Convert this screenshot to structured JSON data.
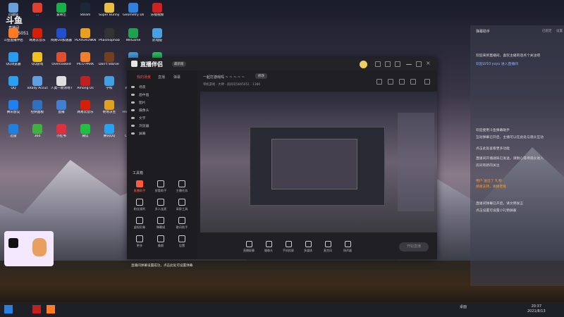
{
  "overlay": {
    "brand": "斗鱼",
    "sub": "直播间",
    "room_id": "5665051"
  },
  "desktop_icons": [
    {
      "label": "回收站",
      "color": "#6aa0d8"
    },
    {
      "label": "…",
      "color": "#e04030"
    },
    {
      "label": "爱奇艺",
      "color": "#18b048"
    },
    {
      "label": "Steam",
      "color": "#1b2838"
    },
    {
      "label": "Super Bunny Man",
      "color": "#e8c040"
    },
    {
      "label": "Geometry Dash",
      "color": "#3080e0"
    },
    {
      "label": "乐视视频",
      "color": "#d02020"
    },
    {
      "label": "斗鱼直播伴侣",
      "color": "#ff7a20"
    },
    {
      "label": "网易云音乐",
      "color": "#d81e06"
    },
    {
      "label": "网易UU加速器",
      "color": "#2050d0"
    },
    {
      "label": "PLAYERUNKNOWN'S BATTLEGR…",
      "color": "#e8a020"
    },
    {
      "label": "Phasmophobia",
      "color": "#333"
    },
    {
      "label": "WeGame",
      "color": "#20a050"
    },
    {
      "label": "此电脑",
      "color": "#4aa0e0"
    },
    {
      "label": "QQ浏览器",
      "color": "#2a9cf0"
    },
    {
      "label": "QQ游戏",
      "color": "#f0c020"
    },
    {
      "label": "Overcooked",
      "color": "#e05030"
    },
    {
      "label": "PICO PARK",
      "color": "#f08030"
    },
    {
      "label": "Don't Starve Together",
      "color": "#704020"
    },
    {
      "label": "网络",
      "color": "#4aa0e0"
    },
    {
      "label": "QQ音乐",
      "color": "#30c060"
    },
    {
      "label": "QQ",
      "color": "#2aa0f0"
    },
    {
      "label": "Totally Accurate…",
      "color": "#60a0e0"
    },
    {
      "label": "人类一败涂地 Human Fa…",
      "color": "#e0e0e0"
    },
    {
      "label": "Among Us",
      "color": "#c02020"
    },
    {
      "label": "学校",
      "color": "#40a0e0"
    },
    {
      "label": "网易云游戏",
      "color": "#e03030"
    },
    {
      "label": "WPS Office",
      "color": "#d03030"
    },
    {
      "label": "腾讯会议",
      "color": "#2080f0"
    },
    {
      "label": "控制面板",
      "color": "#3070c0"
    },
    {
      "label": "直播",
      "color": "#4080d0"
    },
    {
      "label": "网易云音乐",
      "color": "#d81e06"
    },
    {
      "label": "绝地求生",
      "color": "#e0a020"
    },
    {
      "label": "Hellblade Senua…",
      "color": "#555"
    },
    {
      "label": "Stardew Valley",
      "color": "#60a030"
    },
    {
      "label": "迅雷",
      "color": "#2080e0"
    },
    {
      "label": "360",
      "color": "#40b040"
    },
    {
      "label": "小红书",
      "color": "#e03040"
    },
    {
      "label": "微信",
      "color": "#20c040"
    },
    {
      "label": "腾讯QQ",
      "color": "#2aa0f0"
    },
    {
      "label": "CrabGame",
      "color": "#e06040"
    }
  ],
  "window": {
    "app_title": "直播伴侣",
    "version": "最新版",
    "tabs": [
      "我的场景",
      "直播",
      "弹幕"
    ],
    "scene_items": [
      "场景",
      "画中画",
      "图片",
      "摄像头",
      "文字",
      "浏览器",
      "屏幕"
    ],
    "tools_title": "工具箱",
    "tools": [
      {
        "label": "直播助手",
        "red": true
      },
      {
        "label": "房管助手",
        "red": false
      },
      {
        "label": "主播任务",
        "red": false
      },
      {
        "label": "粉丝福利",
        "red": false
      },
      {
        "label": "多人连麦",
        "red": false
      },
      {
        "label": "录屏工具",
        "red": false
      },
      {
        "label": "虚拟形象",
        "red": false
      },
      {
        "label": "弹幕姬",
        "red": false
      },
      {
        "label": "歌词助手",
        "red": false
      },
      {
        "label": "更多",
        "red": false
      },
      {
        "label": "美颜",
        "red": false
      },
      {
        "label": "设置",
        "red": false
      }
    ],
    "channel_title": "一起打游戏吗 ~ ~ ~ ~ ~",
    "channel_badge": "修改",
    "channel_sub": "单机游戏 · 大神 · 房间号5665051 · 1366",
    "bottom_buttons": [
      "直播屏幕",
      "摄像头",
      "手机投屏",
      "多媒体",
      "麦克风",
      "扬声器"
    ],
    "start_label": "开始直播",
    "notice": "直播间弹幕设置成功，点击此处可设置弹幕"
  },
  "chat": {
    "title": "弹幕助手",
    "actions": [
      "已锁定",
      "设置"
    ],
    "lines": [
      {
        "text": "欢迎来到直播间，喜欢主播的话点个关注吧",
        "style": "white"
      },
      {
        "text": "欢迎LV10 yuyu 进入直播间",
        "style": "blue"
      },
      {
        "text": "欢迎使用斗鱼弹幕助手",
        "style": "white"
      },
      {
        "text": "互动弹幕已开启，主播可以在此处与观众互动",
        "style": "white"
      },
      {
        "text": "点击此处查看更多功能",
        "style": "white"
      },
      {
        "text": "直播间开播通知已发送，请耐心等待观众进入",
        "style": "white"
      },
      {
        "text": "房间有新的关注",
        "style": "white"
      },
      {
        "text": "用户 送出了 礼物",
        "style": "orange"
      },
      {
        "text": "感谢支持，谢谢老板",
        "style": "orange"
      },
      {
        "text": "直播间弹幕已开启，请文明发言",
        "style": "white"
      },
      {
        "text": "点击设置可设置小礼物屏蔽",
        "style": "white"
      }
    ]
  },
  "taskbar": {
    "time": "20:37",
    "date": "2021/8/13",
    "tray": "桌面"
  }
}
